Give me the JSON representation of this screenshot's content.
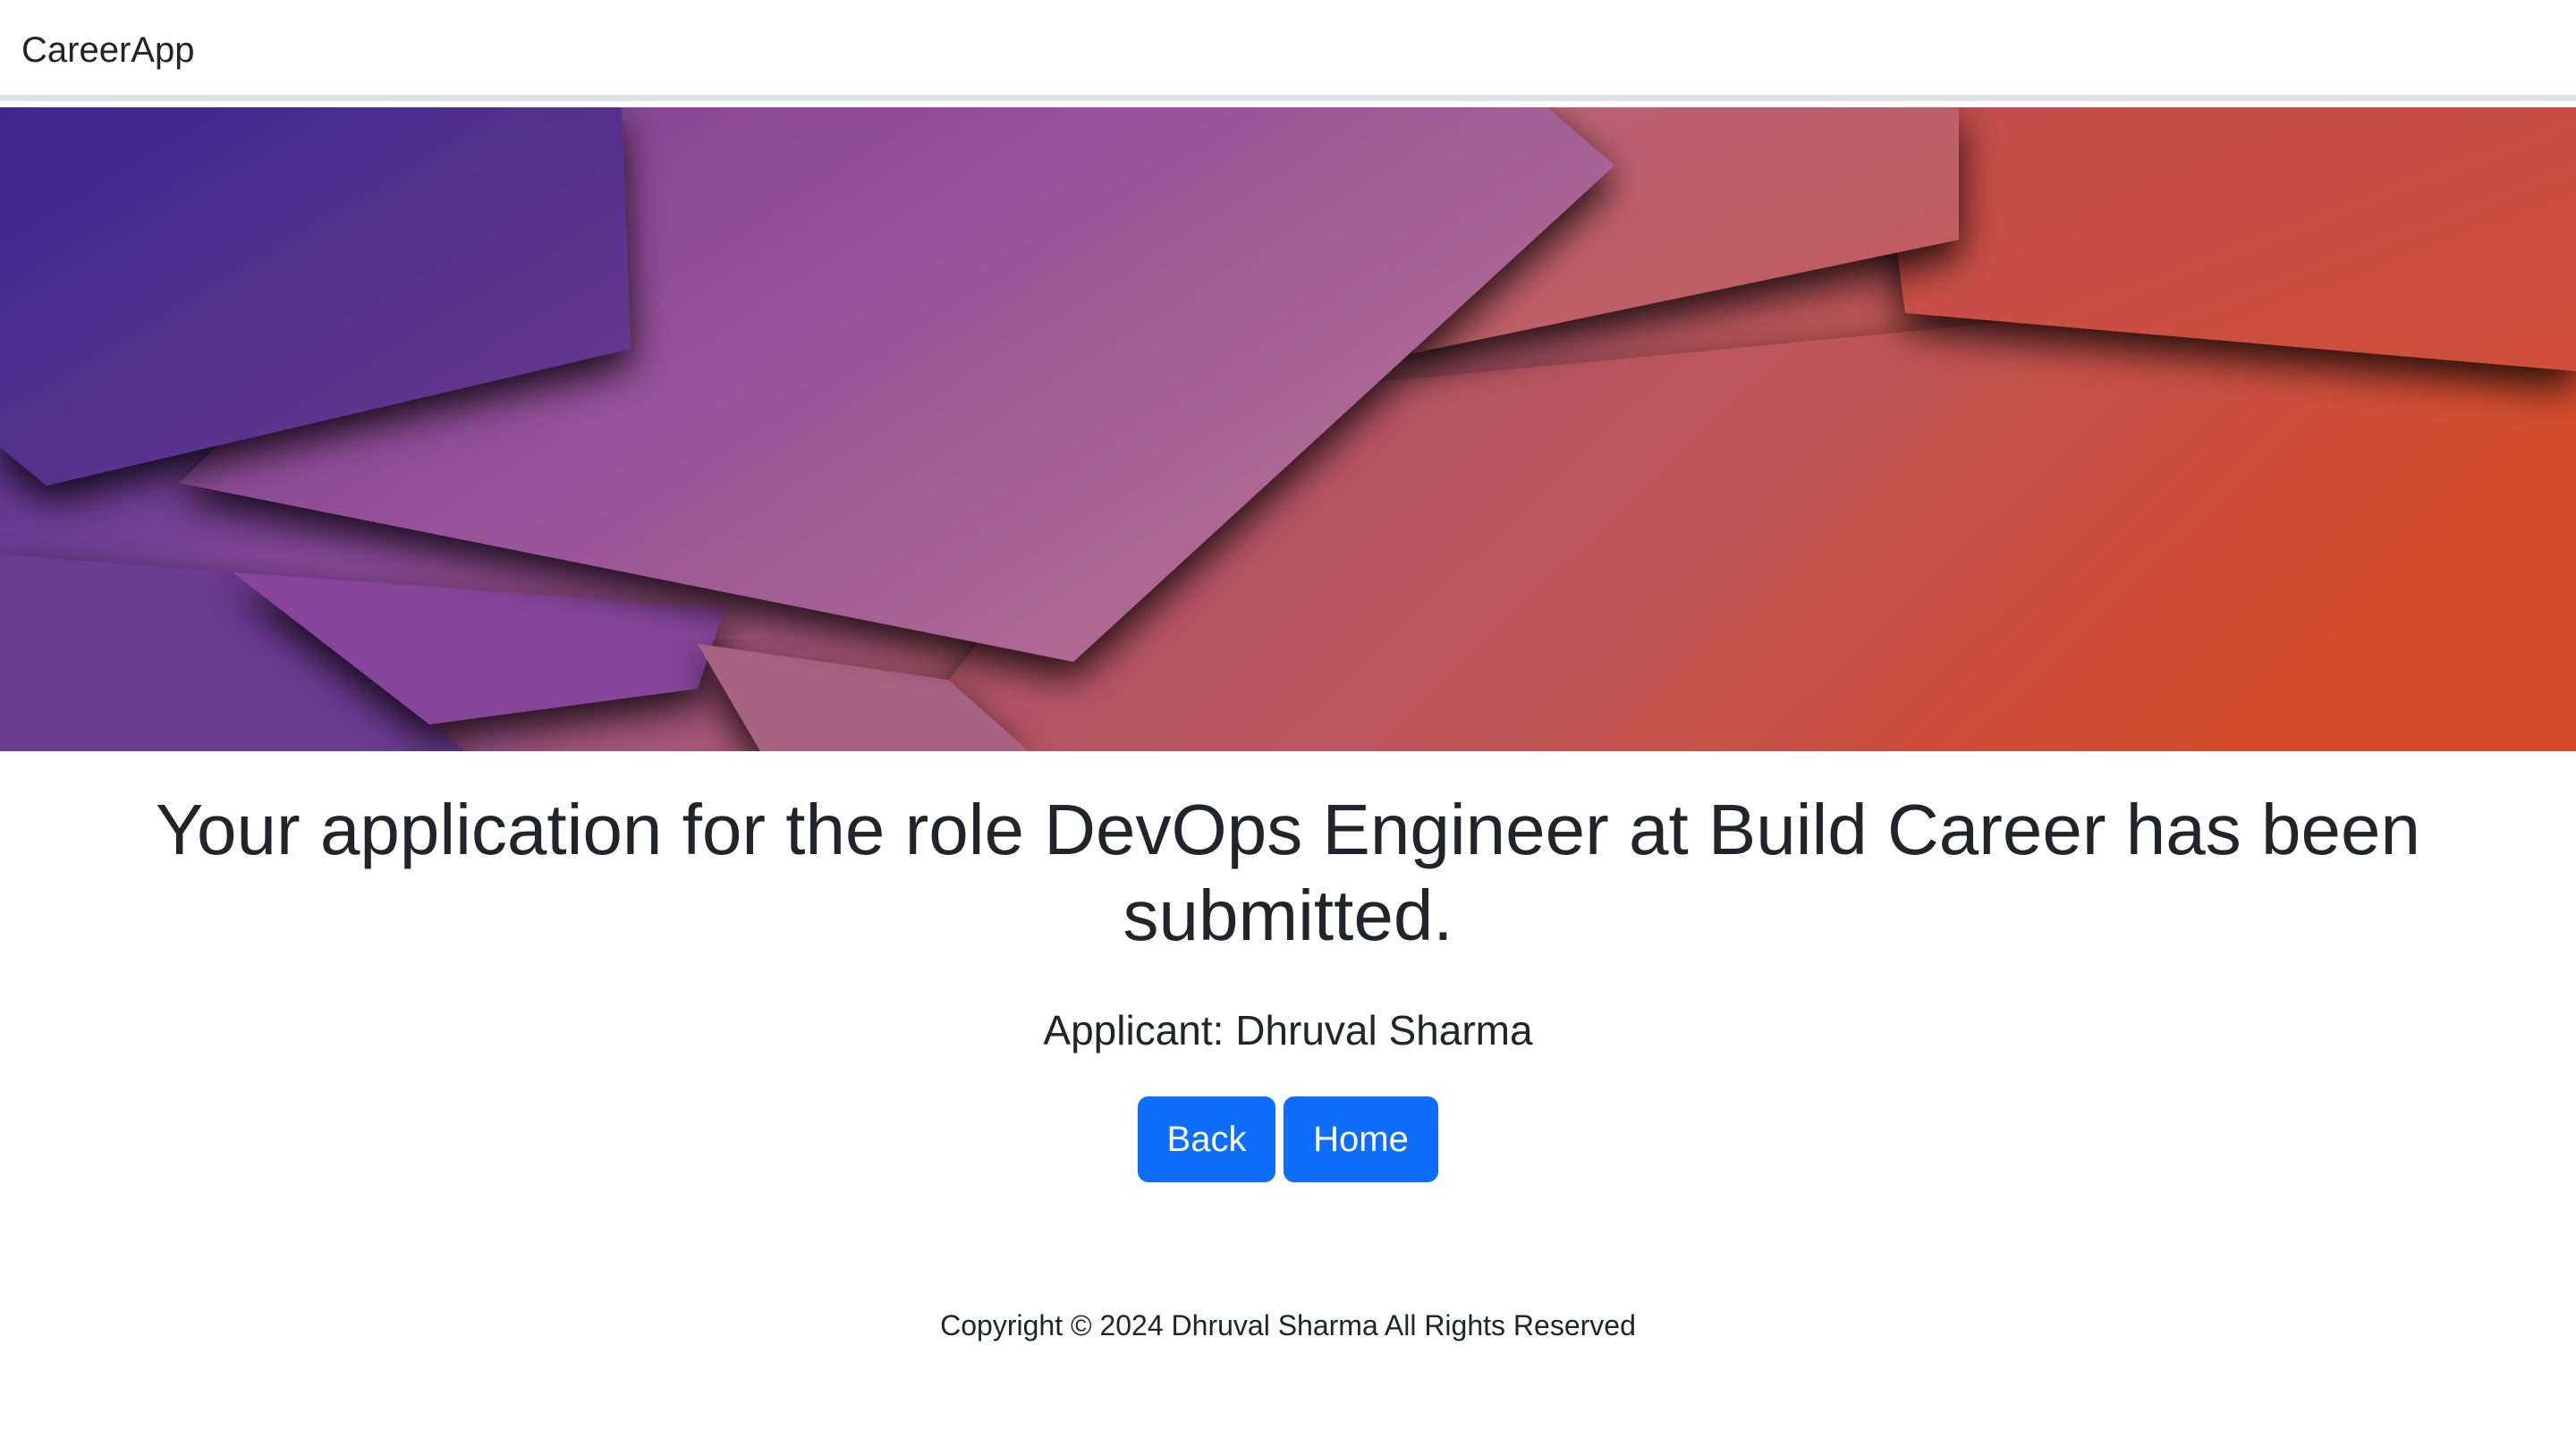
{
  "navbar": {
    "brand": "CareerApp"
  },
  "hero": {
    "image": "abstract-geometric-banner",
    "colors": {
      "left": "#4a2a8c",
      "middle": "#9a5396",
      "right": "#cc4a2a"
    }
  },
  "confirmation": {
    "headline": "Your application for the role DevOps Engineer at Build Career has been submitted.",
    "applicant": "Applicant: Dhruval Sharma"
  },
  "actions": {
    "back_label": "Back",
    "home_label": "Home",
    "button_color": "#0d6efd"
  },
  "footer": {
    "copyright": "Copyright © 2024 Dhruval Sharma All Rights Reserved"
  }
}
